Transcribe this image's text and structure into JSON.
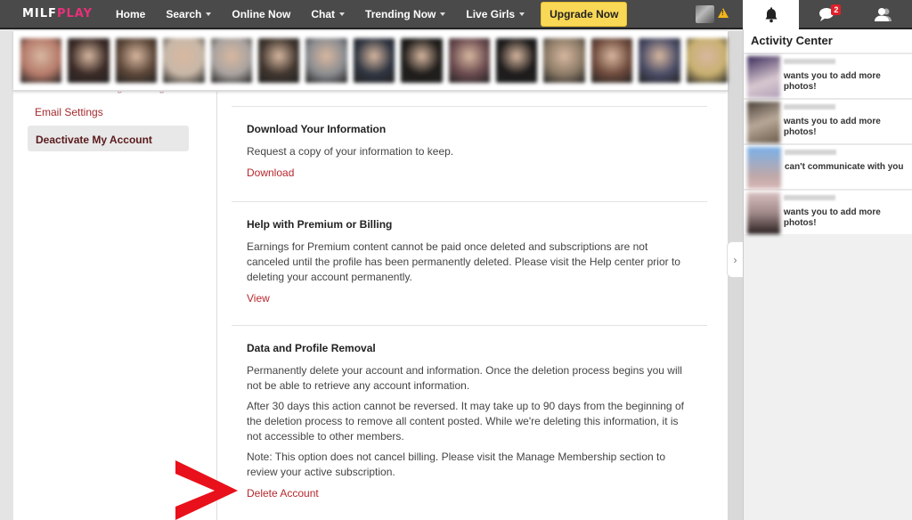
{
  "header": {
    "logo_part1": "MILF",
    "logo_part2": "PLAY",
    "nav": [
      {
        "label": "Home",
        "dropdown": false
      },
      {
        "label": "Search",
        "dropdown": true
      },
      {
        "label": "Online Now",
        "dropdown": false
      },
      {
        "label": "Chat",
        "dropdown": true
      },
      {
        "label": "Trending Now",
        "dropdown": true
      },
      {
        "label": "Live Girls",
        "dropdown": true
      }
    ],
    "upgrade_label": "Upgrade Now",
    "icons": {
      "avatar": "user-avatar",
      "warning": "warning-icon"
    }
  },
  "right_tabs": {
    "notifications_icon": "bell-icon",
    "messages_icon": "chat-bubble-icon",
    "messages_badge": "2",
    "friends_icon": "users-icon"
  },
  "photo_strip": {
    "count": 15,
    "colors": [
      "#b57a6a",
      "#3a2a26",
      "#5b4638",
      "#c8b8a8",
      "#a9a3a0",
      "#3f352e",
      "#8a8c90",
      "#2e3440",
      "#1e1c1a",
      "#6a4a4e",
      "#1c1a1a",
      "#8b7a66",
      "#6e4a3c",
      "#4a4c66",
      "#c8b070"
    ]
  },
  "sidebar": {
    "items": [
      {
        "label": "Advanced Message Settings",
        "state": "partial"
      },
      {
        "label": "Email Settings",
        "state": "normal"
      },
      {
        "label": "Deactivate My Account",
        "state": "active"
      }
    ]
  },
  "content": {
    "sections": [
      {
        "title": "Download Your Information",
        "paragraphs": [
          "Request a copy of your information to keep."
        ],
        "link": "Download"
      },
      {
        "title": "Help with Premium or Billing",
        "paragraphs": [
          "Earnings for Premium content cannot be paid once deleted and subscriptions are not canceled until the profile has been permanently deleted. Please visit the Help center prior to deleting your account permanently."
        ],
        "link": "View"
      },
      {
        "title": "Data and Profile Removal",
        "paragraphs": [
          "Permanently delete your account and information. Once the deletion process begins you will not be able to retrieve any account information.",
          "After 30 days this action cannot be reversed. It may take up to 90 days from the beginning of the deletion process to remove all content posted. While we're deleting this information, it is not accessible to other members.",
          "Note: This option does not cancel billing. Please visit the Manage Membership section to review your active subscription."
        ],
        "link": "Delete Account"
      }
    ]
  },
  "activity_center": {
    "title": "Activity Center",
    "items": [
      {
        "text": "wants you to add more photos!",
        "thumb": "#7a6a8a"
      },
      {
        "text": "wants you to add more photos!",
        "thumb": "#6a6058"
      },
      {
        "text": "can't communicate with you",
        "thumb": "#8ab0d8"
      },
      {
        "text": "wants you to add more photos!",
        "thumb": "#5a4a48"
      }
    ]
  },
  "drawer_toggle": "chevron-right-icon",
  "colors": {
    "accent_red": "#b6282e",
    "nav_bg": "#4a4a4a",
    "upgrade_yellow": "#f9d856",
    "badge_red": "#e0202a",
    "annotation_arrow": "#e8101a"
  }
}
